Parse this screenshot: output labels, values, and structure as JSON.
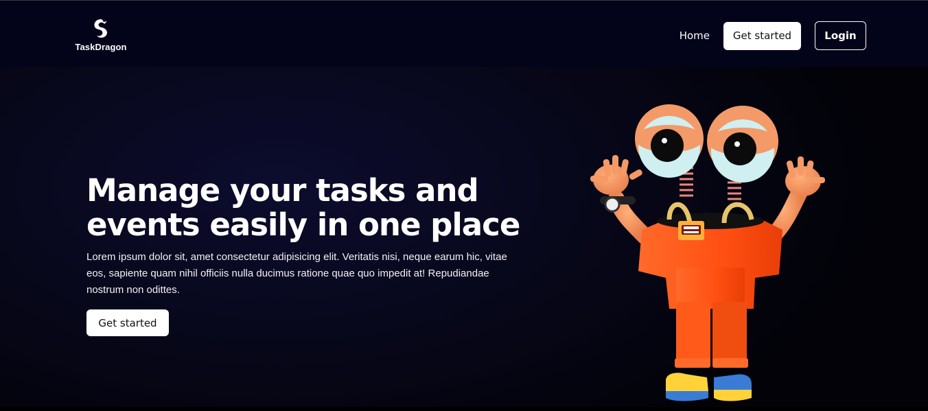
{
  "brand": {
    "name": "TaskDragon",
    "logo_icon": "dragon-icon"
  },
  "nav": {
    "home_label": "Home",
    "get_started_label": "Get started",
    "login_label": "Login"
  },
  "hero": {
    "title": "Manage your tasks and events easily in one place",
    "description": "Lorem ipsum dolor sit, amet consectetur adipisicing elit. Veritatis nisi, neque earum hic, vitae eos, sapiente quam nihil officiis nulla ducimus ratione quae quo impedit at! Repudiandae nostrum non odittes.",
    "cta_label": "Get started",
    "illustration": "orange-character-illustration"
  },
  "colors": {
    "header_bg": "#03041a",
    "hero_bg": "#070719",
    "accent_orange": "#ff5a1f"
  }
}
